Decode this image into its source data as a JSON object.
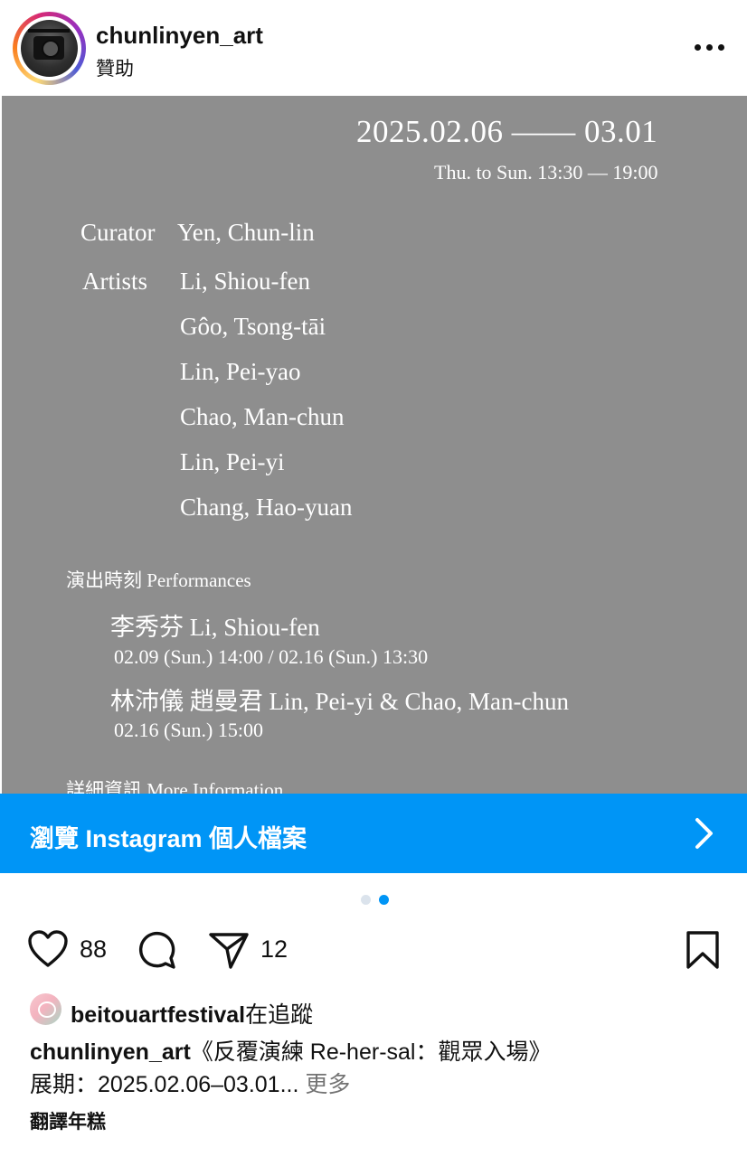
{
  "header": {
    "username": "chunlinyen_art",
    "sponsored_label": "贊助",
    "more_icon": "more-horizontal-icon"
  },
  "poster": {
    "date_range": "2025.02.06 —— 03.01",
    "hours": "Thu. to Sun. 13:30 — 19:00",
    "curator_label": "Curator",
    "curator_name": "Yen, Chun-lin",
    "artists_label": "Artists",
    "artists": [
      "Li, Shiou-fen",
      "Gôo, Tsong-tāi",
      "Lin, Pei-yao",
      "Chao, Man-chun",
      "Lin, Pei-yi",
      "Chang, Hao-yuan"
    ],
    "performances_heading": "演出時刻 Performances",
    "performances": [
      {
        "name": "李秀芬 Li, Shiou-fen",
        "time": "02.09 (Sun.) 14:00  /  02.16 (Sun.) 13:30"
      },
      {
        "name": "林沛儀 趙曼君 Lin, Pei-yi & Chao, Man-chun",
        "time": "02.16 (Sun.) 15:00"
      }
    ],
    "more_info_heading": "詳細資訊 More Information",
    "background_color": "#8e8e8e"
  },
  "banner": {
    "label": "瀏覽 Instagram 個人檔案",
    "chevron_icon": "chevron-right-icon",
    "color": "#0095f6"
  },
  "carousel": {
    "total": 2,
    "active_index": 1,
    "active_color": "#0095f6",
    "inactive_color": "#dbe3ec"
  },
  "actions": {
    "likes": "88",
    "shares": "12",
    "icons": [
      "heart-icon",
      "comment-icon",
      "share-icon",
      "bookmark-icon"
    ]
  },
  "follower": {
    "account": "beitouartfestival",
    "suffix": "在追蹤"
  },
  "caption": {
    "username": "chunlinyen_art",
    "text": "《反覆演練 Re-her-sal：觀眾入場》",
    "line2": "展期：2025.02.06–03.01...",
    "more": "更多"
  },
  "translate_label": "翻譯年糕"
}
